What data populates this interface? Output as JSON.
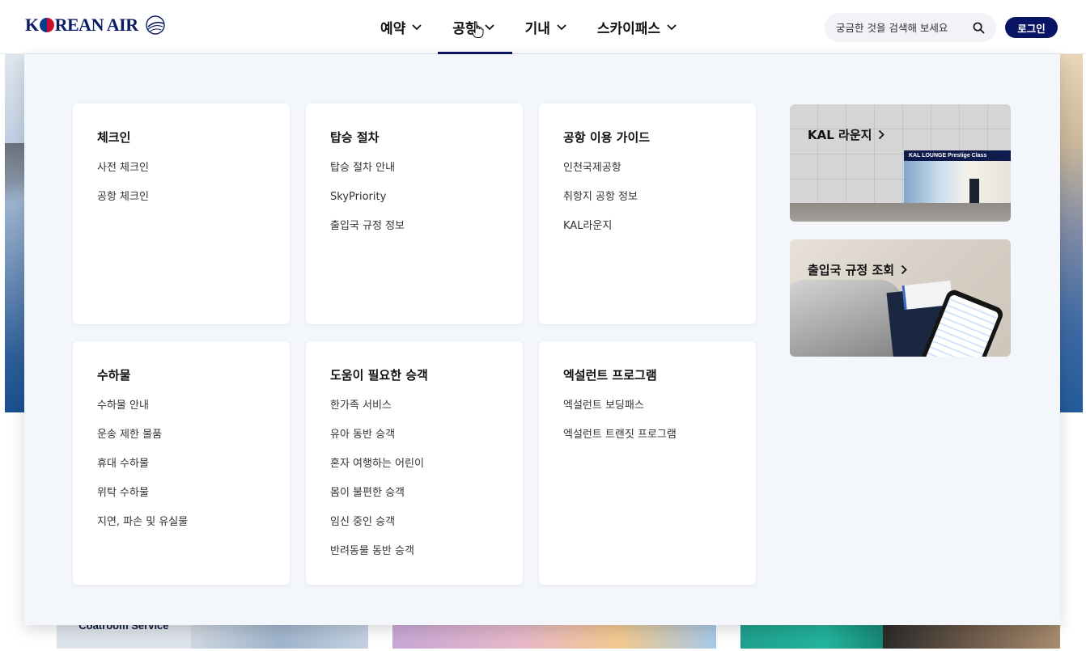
{
  "header": {
    "logo_text_k": "K",
    "logo_text_rest": "REAN AIR",
    "nav": [
      {
        "label": "예약"
      },
      {
        "label": "공항"
      },
      {
        "label": "기내"
      },
      {
        "label": "스카이패스"
      }
    ],
    "active_nav": "공항",
    "search": {
      "placeholder": "궁금한 것을 검색해 보세요"
    },
    "login_label": "로그인"
  },
  "mega_menu": {
    "sections": [
      {
        "title": "체크인",
        "items": [
          "사전 체크인",
          "공항 체크인"
        ]
      },
      {
        "title": "탑승 절차",
        "items": [
          "탑승 절차 안내",
          "SkyPriority",
          "출입국 규정 정보"
        ]
      },
      {
        "title": "공항 이용 가이드",
        "items": [
          "인천국제공항",
          "취항지 공항 정보",
          "KAL라운지"
        ]
      },
      {
        "title": "수하물",
        "items": [
          "수하물 안내",
          "운송 제한 물품",
          "휴대 수하물",
          "위탁 수하물",
          "지연, 파손 및 유실물"
        ]
      },
      {
        "title": "도움이 필요한 승객",
        "items": [
          "한가족 서비스",
          "유아 동반 승객",
          "혼자 여행하는 어린이",
          "몸이 불편한 승객",
          "임신 중인 승객",
          "반려동물 동반 승객"
        ]
      },
      {
        "title": "엑설런트 프로그램",
        "items": [
          "엑설런트 보딩패스",
          "엑설런트 트랜짓 프로그램"
        ]
      }
    ],
    "promos": [
      {
        "title": "KAL 라운지",
        "sign": "KAL LOUNGE Prestige Class"
      },
      {
        "title": "출입국 규정 조회"
      }
    ]
  },
  "background": {
    "coatroom_label": "Coatroom Service"
  },
  "colors": {
    "brand_navy": "#0a1464",
    "panel_bg": "#f3f6fa"
  }
}
